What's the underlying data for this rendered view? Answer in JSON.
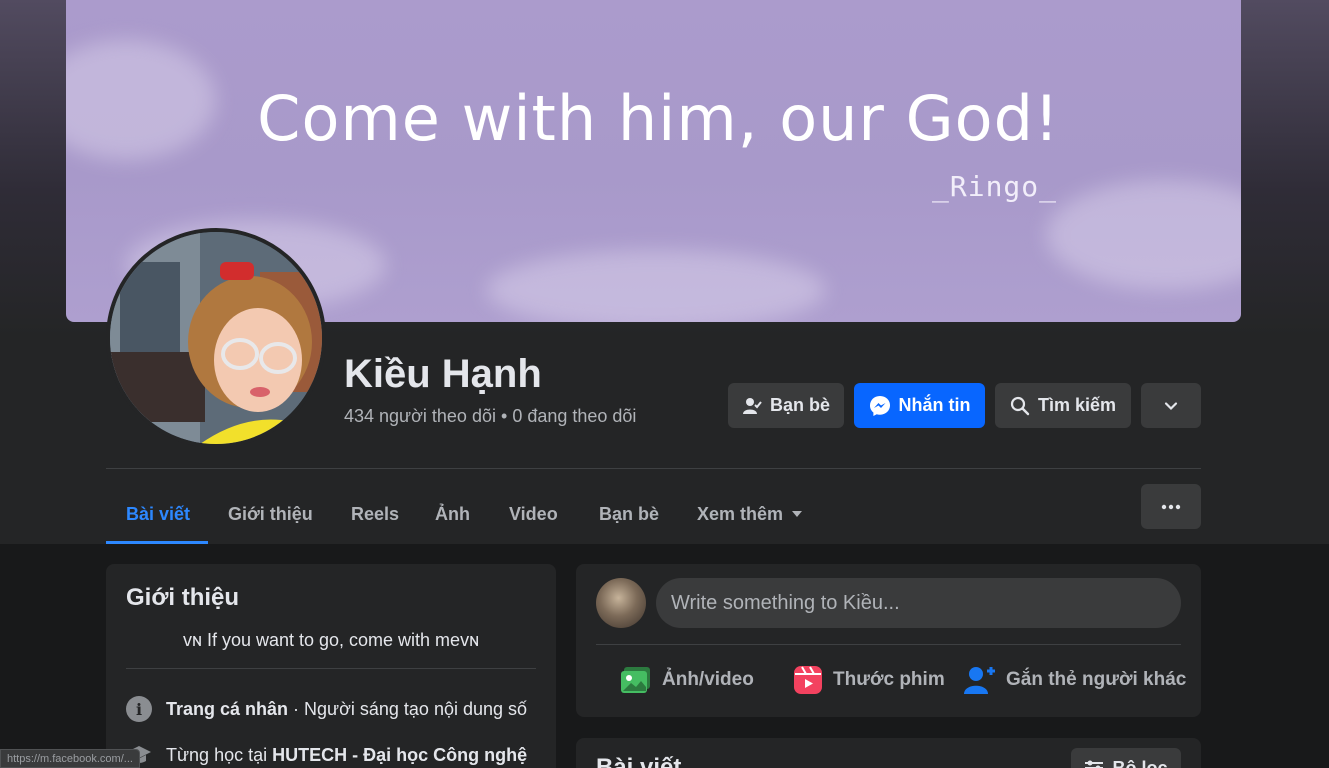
{
  "cover": {
    "quote": "Come with him, our God!",
    "signature": "_Ringo_"
  },
  "profile": {
    "name": "Kiều Hạnh",
    "followers": "434 người theo dõi",
    "separator": "•",
    "following": "0 đang theo dõi"
  },
  "actions": {
    "friends_label": "Bạn bè",
    "message_label": "Nhắn tin",
    "search_label": "Tìm kiếm"
  },
  "tabs": [
    {
      "label": "Bài viết",
      "active": true
    },
    {
      "label": "Giới thiệu"
    },
    {
      "label": "Reels"
    },
    {
      "label": "Ảnh"
    },
    {
      "label": "Video"
    },
    {
      "label": "Bạn bè"
    },
    {
      "label": "Xem thêm"
    }
  ],
  "intro": {
    "title": "Giới thiệu",
    "bio_prefix": "ᴠɴ",
    "bio_text": " If you want to go, come with me",
    "bio_suffix": "ᴠɴ",
    "page_type_label": "Trang cá nhân",
    "page_type_value": " · Người sáng tạo nội dung số",
    "study_prefix": "Từng học tại ",
    "study_school": "HUTECH - Đại học Công nghệ"
  },
  "composer": {
    "placeholder": "Write something to Kiều...",
    "photo_label": "Ảnh/video",
    "reel_label": "Thước phim",
    "tag_label": "Gắn thẻ người khác"
  },
  "posts": {
    "title": "Bài viết",
    "filter_label": "Bộ lọc"
  },
  "status_bar": {
    "url": "https://m.facebook.com/..."
  },
  "colors": {
    "accent": "#0866ff",
    "active_tab": "#2d88ff",
    "photo_icon": "#45bd62",
    "reel_icon": "#f3425f",
    "tag_icon": "#1877f2"
  }
}
